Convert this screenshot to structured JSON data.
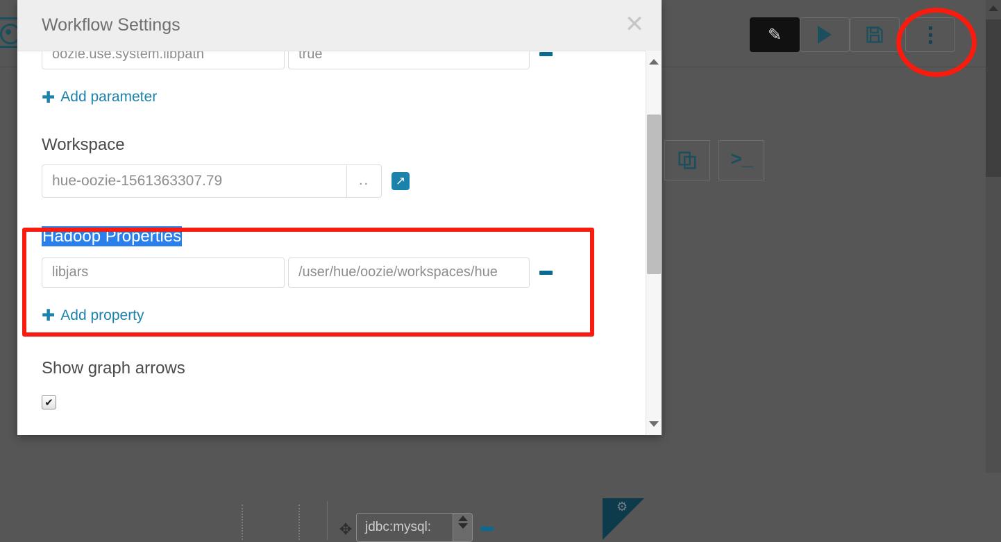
{
  "background": {
    "toolbar": {
      "edit_icon": "pencil-icon",
      "run_icon": "play-icon",
      "save_icon": "floppy-disk-icon",
      "more_icon": "kebab-menu-icon"
    },
    "actions": {
      "copy_icon": "copy-documents-icon",
      "shell_label": ">_"
    },
    "node_fragment": {
      "move_icon": "✥",
      "jdbc_value": "jdbc:mysql:",
      "gears_icon": "⚙"
    },
    "left_icon": "record-circle-icon"
  },
  "modal": {
    "title": "Workflow Settings",
    "close_label": "✕",
    "parameter_row": {
      "key": "oozie.use.system.libpath",
      "value": "true",
      "remove_label": "−"
    },
    "add_parameter": {
      "plus": "✚",
      "label": "Add parameter"
    },
    "workspace": {
      "label": "Workspace",
      "value": "hue-oozie-1561363307.79",
      "browse_label": "..",
      "external_icon": "↗"
    },
    "hadoop_properties": {
      "label": "Hadoop Properties",
      "property_key": "libjars",
      "property_value": "/user/hue/oozie/workspaces/hue",
      "remove_label": "−"
    },
    "add_property": {
      "plus": "✚",
      "label": "Add property"
    },
    "show_graph_arrows": {
      "label": "Show graph arrows",
      "checked_mark": "✔"
    }
  },
  "annotations": {
    "highlight_color": "#f81b0e",
    "rect_target": "hadoop-properties-section",
    "ellipse_target": "kebab-menu-button"
  }
}
